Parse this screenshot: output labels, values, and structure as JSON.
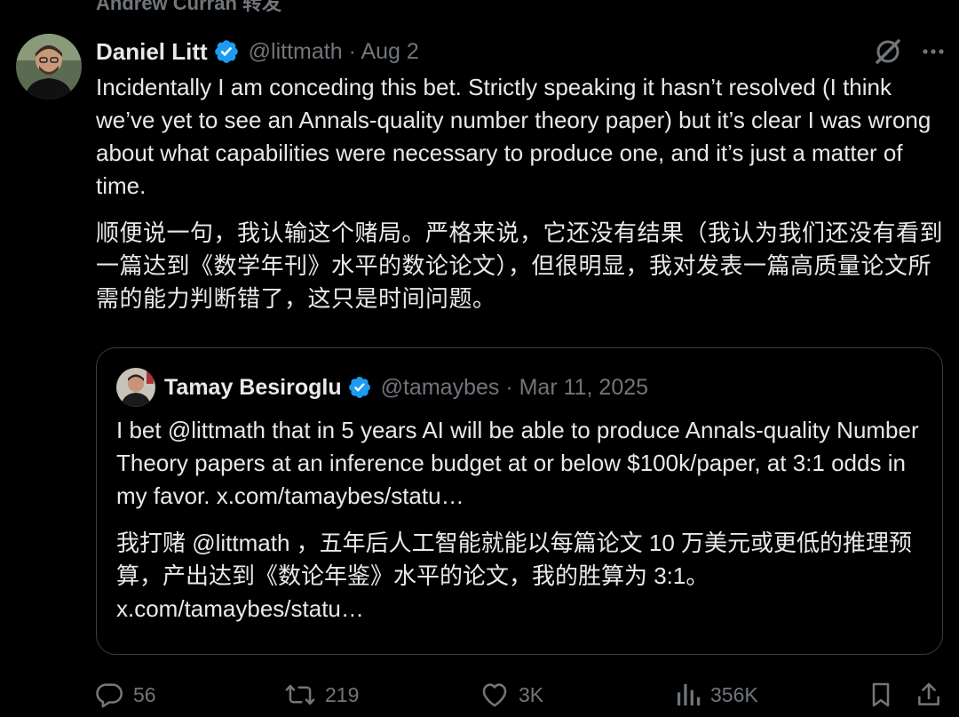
{
  "repost": {
    "text": "Andrew Curran 转发"
  },
  "tweet": {
    "author_name": "Daniel Litt",
    "meta": "@littmath · Aug 2",
    "text_en": "Incidentally I am conceding this bet. Strictly speaking it hasn’t resolved (I think we’ve yet to see an Annals-quality number theory paper) but it’s clear I was wrong about what capabilities were necessary to produce one, and it’s just a matter of time.",
    "text_zh": "顺便说一句，我认输这个赌局。严格来说，它还没有结果（我认为我们还没有看到一篇达到《数学年刊》水平的数论论文），但很明显，我对发表一篇高质量论文所需的能力判断错了，这只是时间问题。"
  },
  "quote": {
    "author_name": "Tamay Besiroglu",
    "meta": "@tamaybes · Mar 11, 2025",
    "text_en": "I bet @littmath that in 5 years AI will be able to produce Annals-quality Number Theory papers at an inference budget at or below $100k/paper, at 3:1 odds in my favor. x.com/tamaybes/statu…",
    "text_zh": "我打赌 @littmath ，五年后人工智能就能以每篇论文 10 万美元或更低的推理预算，产出达到《数论年鉴》水平的论文，我的胜算为 3:1。 x.com/tamaybes/statu…"
  },
  "actions": {
    "replies": "56",
    "reposts": "219",
    "likes": "3K",
    "views": "356K"
  },
  "icons": {
    "top_right": [
      "grok-slash-icon",
      "more-icon"
    ],
    "action_bar": [
      "reply-icon",
      "repost-icon",
      "like-icon",
      "views-icon",
      "bookmark-icon",
      "share-icon"
    ]
  },
  "colors": {
    "background": "#000000",
    "text_primary": "#e7e9ea",
    "text_secondary": "#71767b",
    "verified_blue": "#1d9bf0",
    "border": "#3a3d41"
  }
}
